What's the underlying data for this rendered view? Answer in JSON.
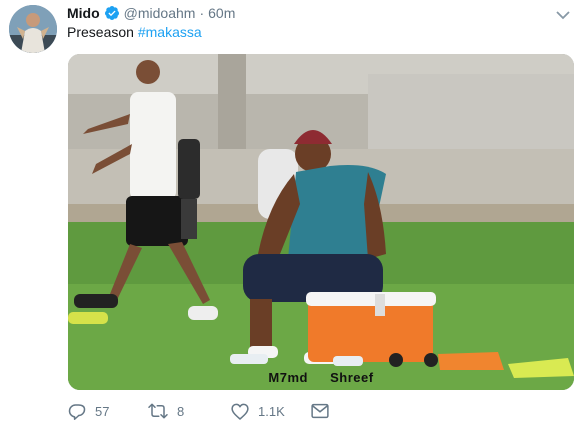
{
  "tweet": {
    "display_name": "Mido",
    "handle": "@midoahm",
    "separator": "·",
    "timestamp": "60m",
    "text_plain": "Preseason ",
    "hashtag": "#makassa",
    "media_caption": "M7md Shreef",
    "icons": {
      "verified": "verified-badge-icon",
      "caret": "chevron-down-icon",
      "reply": "reply-icon",
      "retweet": "retweet-icon",
      "like": "heart-icon",
      "dm": "envelope-icon"
    },
    "stats": {
      "replies": "57",
      "retweets": "8",
      "likes": "1.1K"
    }
  },
  "colors": {
    "accent": "#1da1f2",
    "secondary_text": "#657786",
    "primary_text": "#14171a"
  }
}
